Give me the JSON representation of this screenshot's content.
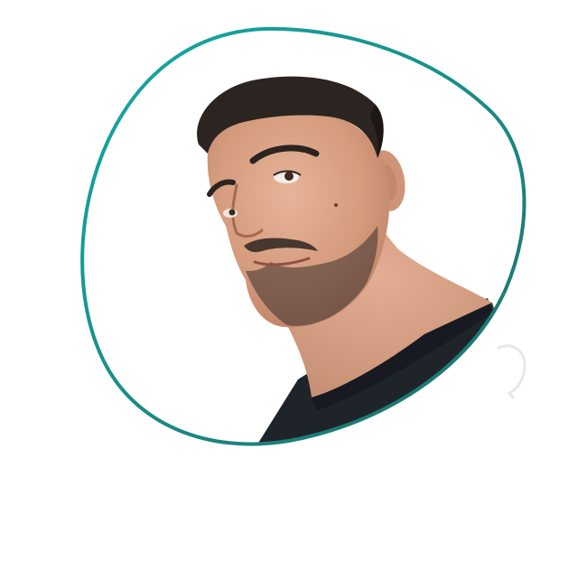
{
  "profile_photo": {
    "subject": "portrait-photo",
    "frame_color_start": "#14aaa5",
    "frame_color_end": "#1f6f6a",
    "background": "#ffffff",
    "shirt_color": "#1f242a",
    "skin_color": "#d9a184",
    "hair_color": "#2b2420"
  }
}
